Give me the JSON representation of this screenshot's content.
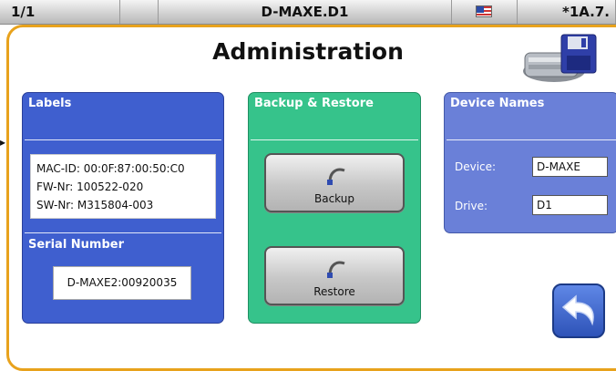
{
  "statusbar": {
    "page": "1/1",
    "title": "D-MAXE.D1",
    "code": "*1A.7."
  },
  "page_title": "Administration",
  "labels_panel": {
    "title": "Labels",
    "mac": "MAC-ID: 00:0F:87:00:50:C0",
    "fw": "FW-Nr: 100522-020",
    "sw": "SW-Nr: M315804-003",
    "serial_title": "Serial Number",
    "serial_value": "D-MAXE2:00920035"
  },
  "backup_panel": {
    "title": "Backup & Restore",
    "backup_label": "Backup",
    "restore_label": "Restore"
  },
  "names_panel": {
    "title": "Device Names",
    "device_label": "Device:",
    "device_value": "D-MAXE",
    "drive_label": "Drive:",
    "drive_value": "D1"
  },
  "colors": {
    "frame": "#e8a21c",
    "labels_panel": "#3f5fcf",
    "backup_panel": "#36c38b",
    "names_panel": "#6a80d8"
  },
  "icons": [
    "flag-icon",
    "save-disk-icon",
    "undo-arrow-icon",
    "back-arrow-icon"
  ]
}
